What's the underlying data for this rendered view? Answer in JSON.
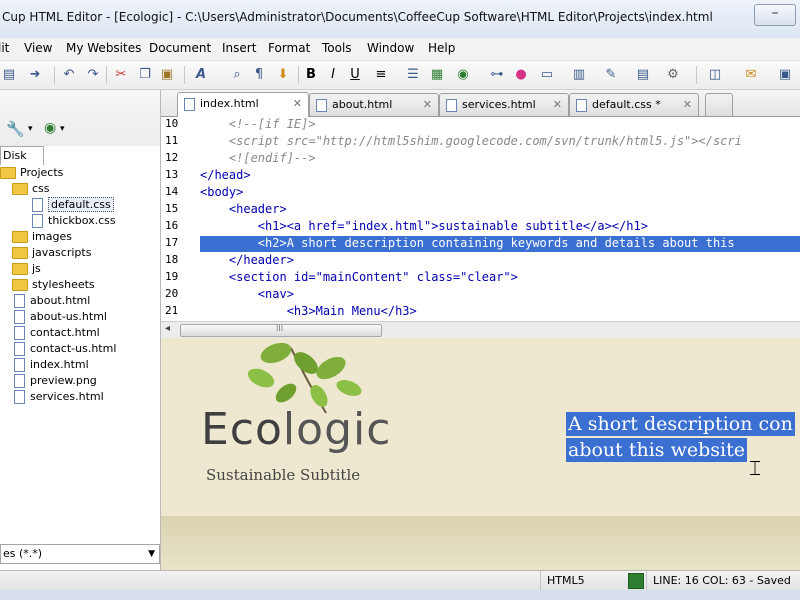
{
  "window": {
    "title": "Cup HTML Editor - [Ecologic] - C:\\Users\\Administrator\\Documents\\CoffeeCup Software\\HTML Editor\\Projects\\index.html",
    "minimize_glyph": "–"
  },
  "menu": {
    "items": [
      "lit",
      "View",
      "My Websites",
      "Document",
      "Insert",
      "Format",
      "Tools",
      "Window",
      "Help"
    ]
  },
  "toolbar": {
    "icons": [
      "new-icon",
      "open-icon",
      "undo-icon",
      "redo-icon",
      "cut-icon",
      "copy-icon",
      "paste-icon",
      "font-icon",
      "find-icon",
      "paragraph-icon",
      "insert-icon",
      "bold-icon",
      "italic-icon",
      "underline-icon",
      "align-icon",
      "list-icon",
      "table-icon",
      "image-icon",
      "globe-icon",
      "link-icon",
      "color-icon",
      "box-icon",
      "layout-icon",
      "edit-icon",
      "doc-icon",
      "gear-icon",
      "frame-icon",
      "publish-icon",
      "preview-icon"
    ]
  },
  "left_panel": {
    "tab_label": "Disk",
    "filter_value": "es (*.*)",
    "tree": [
      {
        "label": "Projects",
        "type": "folder",
        "indent": 0
      },
      {
        "label": "css",
        "type": "folder",
        "indent": 1
      },
      {
        "label": "default.css",
        "type": "file",
        "indent": 2,
        "selected": true
      },
      {
        "label": "thickbox.css",
        "type": "file",
        "indent": 2
      },
      {
        "label": "images",
        "type": "folder",
        "indent": 1
      },
      {
        "label": "javascripts",
        "type": "folder",
        "indent": 1
      },
      {
        "label": "js",
        "type": "folder",
        "indent": 1
      },
      {
        "label": "stylesheets",
        "type": "folder",
        "indent": 1
      },
      {
        "label": "about.html",
        "type": "file",
        "indent": 1
      },
      {
        "label": "about-us.html",
        "type": "file",
        "indent": 1
      },
      {
        "label": "contact.html",
        "type": "file",
        "indent": 1
      },
      {
        "label": "contact-us.html",
        "type": "file",
        "indent": 1
      },
      {
        "label": "index.html",
        "type": "file",
        "indent": 1
      },
      {
        "label": "preview.png",
        "type": "file",
        "indent": 1
      },
      {
        "label": "services.html",
        "type": "file",
        "indent": 1
      }
    ]
  },
  "tabs": [
    {
      "label": "index.html",
      "active": true
    },
    {
      "label": "about.html",
      "active": false
    },
    {
      "label": "services.html",
      "active": false
    },
    {
      "label": "default.css *",
      "active": false
    }
  ],
  "tab_close_glyph": "✕",
  "code": {
    "lines": [
      {
        "num": "10",
        "text": "    <!--[if IE]>",
        "kind": "comment"
      },
      {
        "num": "11",
        "text": "    <script src=\"http://html5shim.googlecode.com/svn/trunk/html5.js\"></scri",
        "kind": "comment"
      },
      {
        "num": "12",
        "text": "    <![endif]-->",
        "kind": "comment"
      },
      {
        "num": "13",
        "text": "</head>",
        "kind": "tag"
      },
      {
        "num": "14",
        "text": "<body>",
        "kind": "tag"
      },
      {
        "num": "15",
        "text": "    <header>",
        "kind": "tag"
      },
      {
        "num": "16",
        "text": "        <h1><a href=\"index.html\">sustainable subtitle</a></h1>",
        "kind": "tag"
      },
      {
        "num": "17",
        "text": "        <h2>A short description containing keywords and details about this",
        "kind": "highlight"
      },
      {
        "num": "18",
        "text": "    </header>",
        "kind": "tag"
      },
      {
        "num": "19",
        "text": "    <section id=\"mainContent\" class=\"clear\">",
        "kind": "tag"
      },
      {
        "num": "20",
        "text": "        <nav>",
        "kind": "tag"
      },
      {
        "num": "21",
        "text": "            <h3>Main Menu</h3>",
        "kind": "tag"
      }
    ]
  },
  "scrollbar": {
    "left_arrow": "◂",
    "grip": "III"
  },
  "preview": {
    "brand_bold": "Eco",
    "brand_light": "logic",
    "subtitle": "Sustainable Subtitle",
    "selected_line1": "A short description con",
    "selected_line2": "about this website"
  },
  "status": {
    "doctype": "HTML5",
    "position": "LINE: 16  COL: 63 - Saved"
  },
  "colors": {
    "selection": "#3b6fd1",
    "tag": "#0000b0",
    "preview_bg": "#efe8d0"
  }
}
